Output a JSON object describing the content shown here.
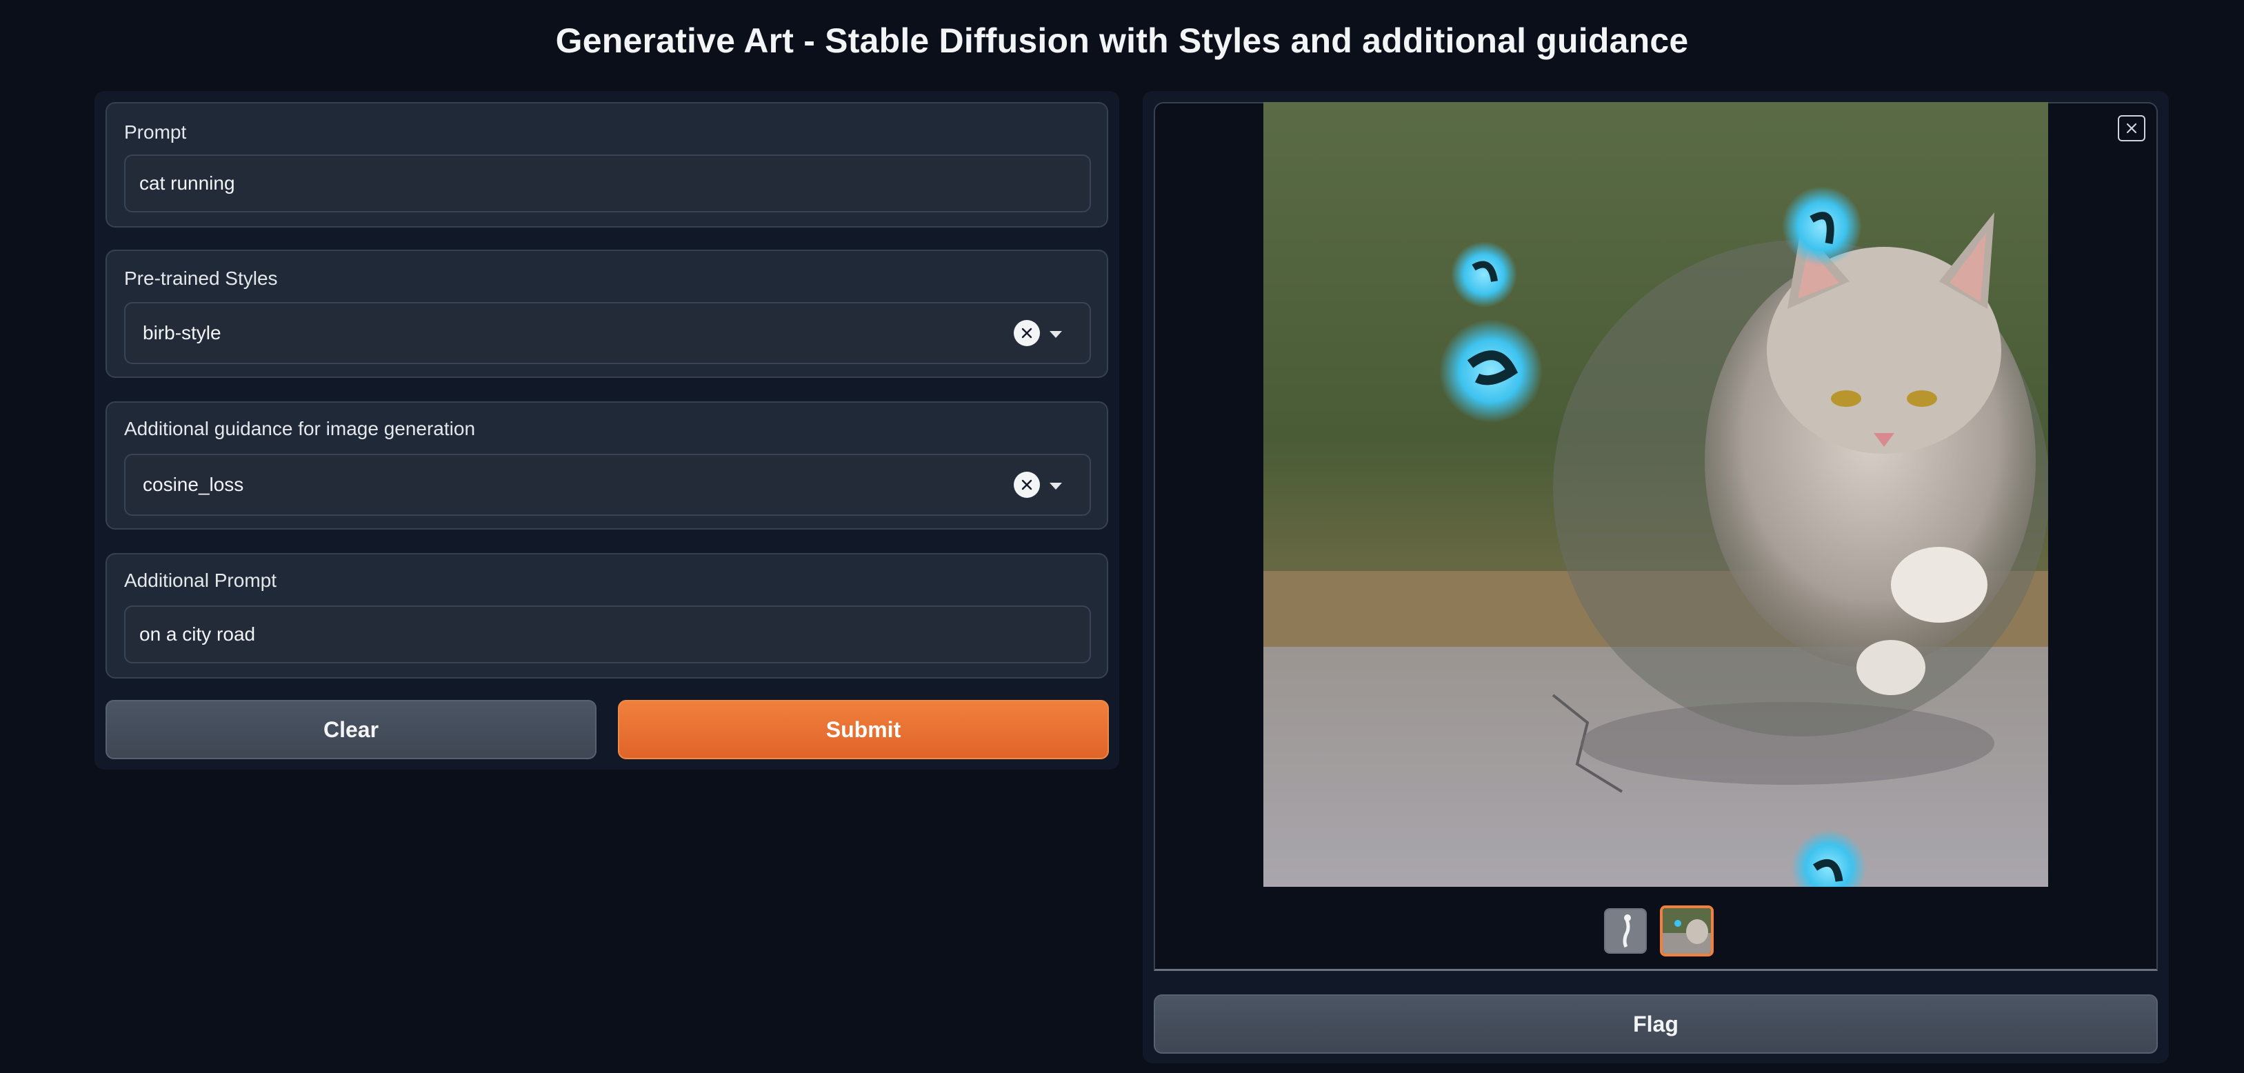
{
  "title": "Generative Art - Stable Diffusion with Styles and additional guidance",
  "prompt": {
    "label": "Prompt",
    "value": "cat running"
  },
  "styles": {
    "label": "Pre-trained Styles",
    "value": "birb-style"
  },
  "guidance": {
    "label": "Additional guidance for image generation",
    "value": "cosine_loss"
  },
  "additional_prompt": {
    "label": "Additional Prompt",
    "value": "on a city road"
  },
  "buttons": {
    "clear": "Clear",
    "submit": "Submit",
    "flag": "Flag"
  },
  "gallery": {
    "selected_index": 1,
    "thumbnail_count": 2
  },
  "colors": {
    "background": "#0b0f19",
    "panel": "#111827",
    "block": "#1f2937",
    "accent": "#f0803c",
    "secondary_button": "#4b5563"
  },
  "icons": {
    "dropdown_clear": "clear-x-icon",
    "dropdown_arrow": "caret-down-icon",
    "gallery_close": "close-icon"
  }
}
